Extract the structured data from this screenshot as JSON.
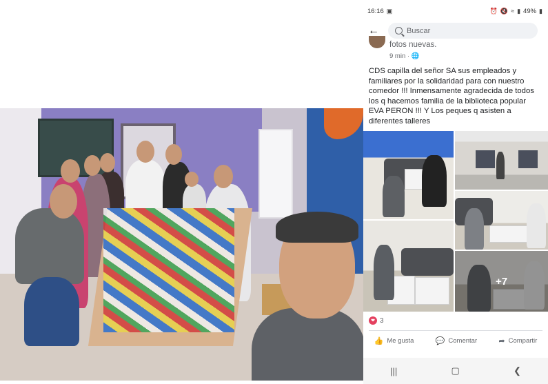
{
  "status_bar": {
    "time": "16:16",
    "battery": "49%"
  },
  "search": {
    "placeholder": "Buscar"
  },
  "post": {
    "subtitle": "fotos nuevas.",
    "time": "9 min",
    "text": "CDS capilla del señor SA sus empleados y familiares por la solidaridad para con nuestro comedor !!! Inmensamente agradecida de todos los q hacemos familia de la biblioteca popular EVA PERON !!! Y Los peques q asisten a diferentes talleres",
    "more_photos": "+7",
    "reaction_count": "3"
  },
  "actions": {
    "like": "Me gusta",
    "comment": "Comentar",
    "share": "Compartir"
  },
  "icons": {
    "back": "arrow-left-icon",
    "search": "search-icon",
    "privacy": "globe-icon",
    "reaction": "heart-icon",
    "like": "thumbs-up-icon",
    "comment": "speech-bubble-icon",
    "share": "share-arrow-icon"
  },
  "colors": {
    "reaction": "#e4405f",
    "search_bg": "#f0f2f5",
    "secondary_text": "#65676b"
  }
}
